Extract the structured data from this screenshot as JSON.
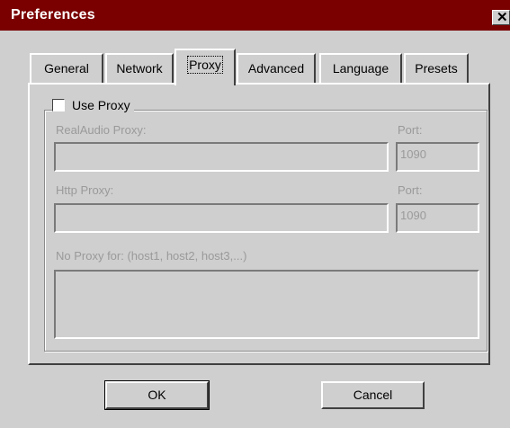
{
  "window": {
    "title": "Preferences",
    "close_glyph": "✕"
  },
  "tabs": [
    {
      "label": "General",
      "active": false
    },
    {
      "label": "Network",
      "active": false
    },
    {
      "label": "Proxy",
      "active": true
    },
    {
      "label": "Advanced",
      "active": false
    },
    {
      "label": "Language",
      "active": false
    },
    {
      "label": "Presets",
      "active": false
    }
  ],
  "proxy": {
    "use_proxy_label": "Use Proxy",
    "use_proxy_checked": false,
    "realaudio_label": "RealAudio Proxy:",
    "realaudio_value": "",
    "realaudio_port_label": "Port:",
    "realaudio_port_value": "1090",
    "http_label": "Http Proxy:",
    "http_value": "",
    "http_port_label": "Port:",
    "http_port_value": "1090",
    "no_proxy_label": "No Proxy for: (host1, host2, host3,...)",
    "no_proxy_value": ""
  },
  "buttons": {
    "ok": "OK",
    "cancel": "Cancel"
  }
}
